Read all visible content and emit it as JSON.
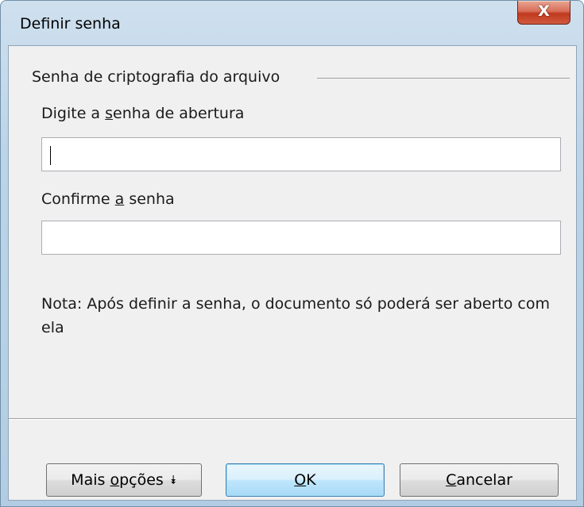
{
  "window": {
    "title": "Definir senha",
    "close_glyph": "X"
  },
  "encryption": {
    "frame_label": "Senha de criptografia do arquivo",
    "open_password_label": {
      "pre": "Digite a ",
      "accel": "s",
      "post": "enha de abertura"
    },
    "open_password_value": "",
    "confirm_label": {
      "pre": "Confirme ",
      "accel": "a",
      "post": " senha"
    },
    "confirm_value": "",
    "note": "Nota: Após definir a senha, o documento só poderá ser aberto com ela"
  },
  "buttons": {
    "more_options": {
      "pre": "Mais ",
      "accel": "o",
      "post": "pções",
      "icon": "double-chevron-down-icon",
      "icon_glyph": "⯯"
    },
    "ok": {
      "accel": "O",
      "post": "K"
    },
    "cancel": {
      "accel": "C",
      "post": "ancelar"
    }
  }
}
